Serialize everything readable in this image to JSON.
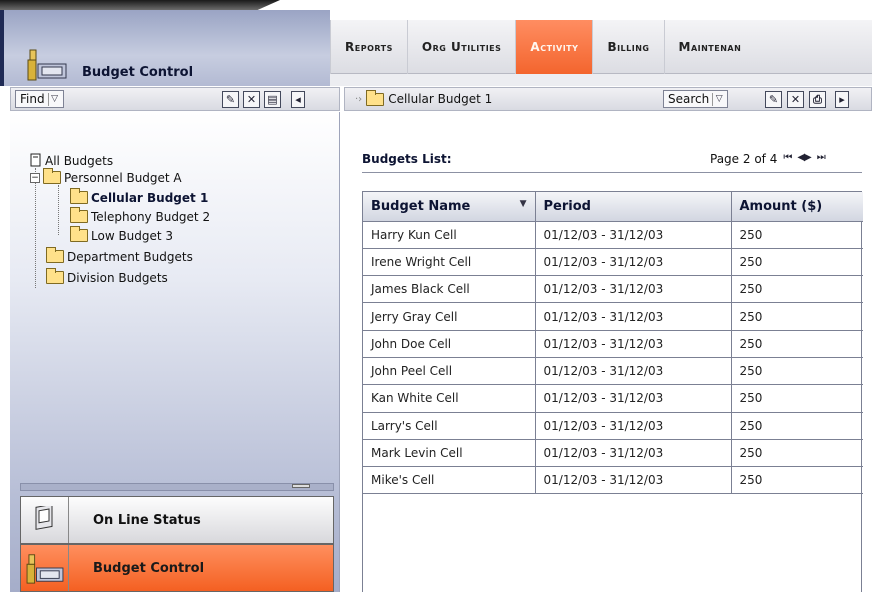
{
  "app": {
    "title": "Budget Control"
  },
  "nav": {
    "items": [
      {
        "label": "Reports",
        "active": false
      },
      {
        "label": "Org Utilities",
        "active": false
      },
      {
        "label": "Activity",
        "active": true
      },
      {
        "label": "Billing",
        "active": false
      },
      {
        "label": "Maintenan",
        "active": false
      }
    ]
  },
  "left_toolbar": {
    "find_label": "Find"
  },
  "right_toolbar": {
    "breadcrumb": "Cellular Budget 1",
    "search_label": "Search"
  },
  "tree": {
    "root": "All Budgets",
    "items": [
      {
        "label": "Personnel Budget A"
      },
      {
        "label": "Cellular Budget 1"
      },
      {
        "label": "Telephony Budget 2"
      },
      {
        "label": "Low Budget 3"
      },
      {
        "label": "Department Budgets"
      },
      {
        "label": "Division Budgets"
      }
    ]
  },
  "modules": {
    "online": "On Line Status",
    "budget": "Budget Control"
  },
  "list": {
    "title": "Budgets List:",
    "page_text": "Page 2 of 4",
    "columns": [
      "Budget Name",
      "Period",
      "Amount ($)"
    ],
    "rows": [
      [
        "Harry Kun Cell",
        "01/12/03 - 31/12/03",
        "250"
      ],
      [
        "Irene Wright Cell",
        "01/12/03 - 31/12/03",
        "250"
      ],
      [
        "James Black Cell",
        "01/12/03 - 31/12/03",
        "250"
      ],
      [
        "Jerry Gray Cell",
        "01/12/03 - 31/12/03",
        "250"
      ],
      [
        "John Doe Cell",
        "01/12/03 - 31/12/03",
        "250"
      ],
      [
        "John Peel Cell",
        "01/12/03 - 31/12/03",
        "250"
      ],
      [
        "Kan White Cell",
        "01/12/03 - 31/12/03",
        "250"
      ],
      [
        "Larry's Cell",
        "01/12/03 - 31/12/03",
        "250"
      ],
      [
        "Mark Levin Cell",
        "01/12/03 - 31/12/03",
        "250"
      ],
      [
        "Mike's Cell",
        "01/12/03 - 31/12/03",
        "250"
      ]
    ]
  }
}
